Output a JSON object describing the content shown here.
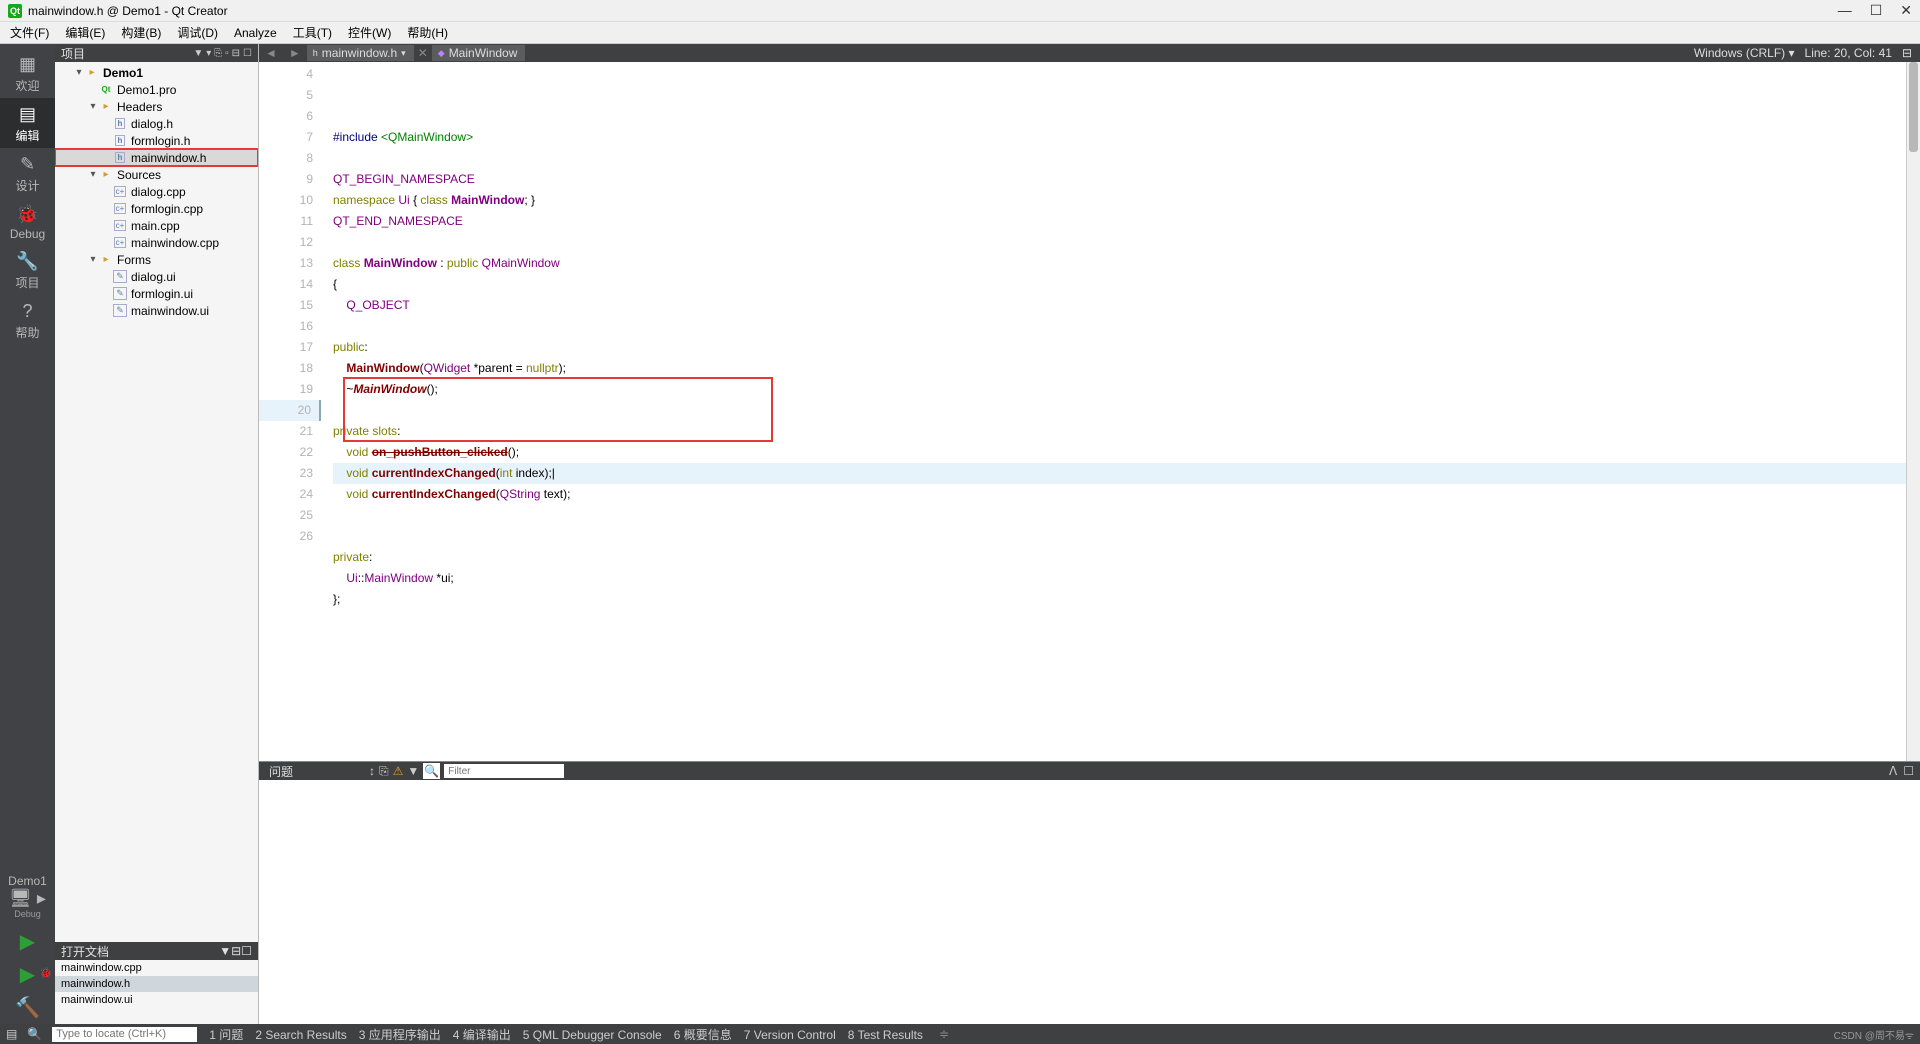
{
  "title": "mainwindow.h @ Demo1 - Qt Creator",
  "menus": [
    "文件(F)",
    "编辑(E)",
    "构建(B)",
    "调试(D)",
    "Analyze",
    "工具(T)",
    "控件(W)",
    "帮助(H)"
  ],
  "left_dock": {
    "items": [
      {
        "icon": "▦",
        "label": "欢迎"
      },
      {
        "icon": "▤",
        "label": "编辑",
        "active": true
      },
      {
        "icon": "✎",
        "label": "设计"
      },
      {
        "icon": "🐞",
        "label": "Debug"
      },
      {
        "icon": "🔧",
        "label": "项目"
      },
      {
        "icon": "?",
        "label": "帮助"
      }
    ],
    "target": {
      "name": "Demo1",
      "kit": "",
      "config": "Debug"
    }
  },
  "sidebar": {
    "header": "项目",
    "tree": [
      {
        "level": 1,
        "expand": "▾",
        "icon": "folder",
        "label": "Demo1",
        "bold": true
      },
      {
        "level": 2,
        "expand": "",
        "icon": "pro",
        "label": "Demo1.pro"
      },
      {
        "level": 2,
        "expand": "▾",
        "icon": "folder",
        "label": "Headers"
      },
      {
        "level": 3,
        "expand": "",
        "icon": "h",
        "label": "dialog.h"
      },
      {
        "level": 3,
        "expand": "",
        "icon": "h",
        "label": "formlogin.h"
      },
      {
        "level": 3,
        "expand": "",
        "icon": "h",
        "label": "mainwindow.h",
        "selected": true,
        "boxed": true
      },
      {
        "level": 2,
        "expand": "▾",
        "icon": "folder",
        "label": "Sources"
      },
      {
        "level": 3,
        "expand": "",
        "icon": "cpp",
        "label": "dialog.cpp"
      },
      {
        "level": 3,
        "expand": "",
        "icon": "cpp",
        "label": "formlogin.cpp"
      },
      {
        "level": 3,
        "expand": "",
        "icon": "cpp",
        "label": "main.cpp"
      },
      {
        "level": 3,
        "expand": "",
        "icon": "cpp",
        "label": "mainwindow.cpp"
      },
      {
        "level": 2,
        "expand": "▾",
        "icon": "folder",
        "label": "Forms"
      },
      {
        "level": 3,
        "expand": "",
        "icon": "ui",
        "label": "dialog.ui"
      },
      {
        "level": 3,
        "expand": "",
        "icon": "ui",
        "label": "formlogin.ui"
      },
      {
        "level": 3,
        "expand": "",
        "icon": "ui",
        "label": "mainwindow.ui"
      }
    ],
    "open_docs_header": "打开文档",
    "open_docs": [
      {
        "label": "mainwindow.cpp"
      },
      {
        "label": "mainwindow.h",
        "active": true
      },
      {
        "label": "mainwindow.ui"
      }
    ]
  },
  "editor": {
    "crumb_file": "mainwindow.h",
    "crumb_symbol": "MainWindow",
    "encoding": "Windows (CRLF)",
    "cursor": "Line: 20, Col: 41",
    "first_line": 4,
    "current_line": 20,
    "lines": [
      {
        "html": "<span class='preproc'>#include</span> <span class='str'>&lt;QMainWindow&gt;</span>"
      },
      {
        "html": ""
      },
      {
        "html": "<span class='type'>QT_BEGIN_NAMESPACE</span>"
      },
      {
        "html": "<span class='kw'>namespace</span> <span class='type'>Ui</span> { <span class='kw'>class</span> <span class='cls'>MainWindow</span>; }"
      },
      {
        "html": "<span class='type'>QT_END_NAMESPACE</span>"
      },
      {
        "html": ""
      },
      {
        "html": "<span class='kw'>class</span> <span class='cls'>MainWindow</span> : <span class='kw'>public</span> <span class='type'>QMainWindow</span>"
      },
      {
        "html": "{"
      },
      {
        "html": "    <span class='type'>Q_OBJECT</span>"
      },
      {
        "html": ""
      },
      {
        "html": "<span class='kw'>public</span>:"
      },
      {
        "html": "    <span class='fn'>MainWindow</span>(<span class='type'>QWidget</span> *parent = <span class='kw'>nullptr</span>);"
      },
      {
        "html": "    ~<span class='fn ital'>MainWindow</span>();"
      },
      {
        "html": ""
      },
      {
        "html": "<span class='kw'>private</span> <span class='kw'>slots</span>:"
      },
      {
        "html": "    <span class='kw'>void</span> <span class='fn strike'>on_pushButton_clicked</span>();"
      },
      {
        "html": "    <span class='kw'>void</span> <span class='fn'>currentIndexChanged</span>(<span class='kw'>int</span> index);|",
        "current": true
      },
      {
        "html": "    <span class='kw'>void</span> <span class='fn'>currentIndexChanged</span>(<span class='type'>QString</span> text);"
      },
      {
        "html": ""
      },
      {
        "html": ""
      },
      {
        "html": "<span class='kw'>private</span>:"
      },
      {
        "html": "    <span class='type'>Ui</span>::<span class='type'>MainWindow</span> *ui;"
      },
      {
        "html": "};"
      }
    ],
    "redbox": {
      "top_line": 19,
      "bottom_line": 21,
      "width_chars": 44
    }
  },
  "panel": {
    "tab": "问题",
    "filter_placeholder": "Filter"
  },
  "status": {
    "locator_placeholder": "Type to locate (Ctrl+K)",
    "items": [
      "1  问题",
      "2  Search Results",
      "3  应用程序输出",
      "4  编译输出",
      "5  QML Debugger Console",
      "6  概要信息",
      "7  Version Control",
      "8  Test Results"
    ],
    "watermark": "CSDN @周不易ᯤ"
  }
}
